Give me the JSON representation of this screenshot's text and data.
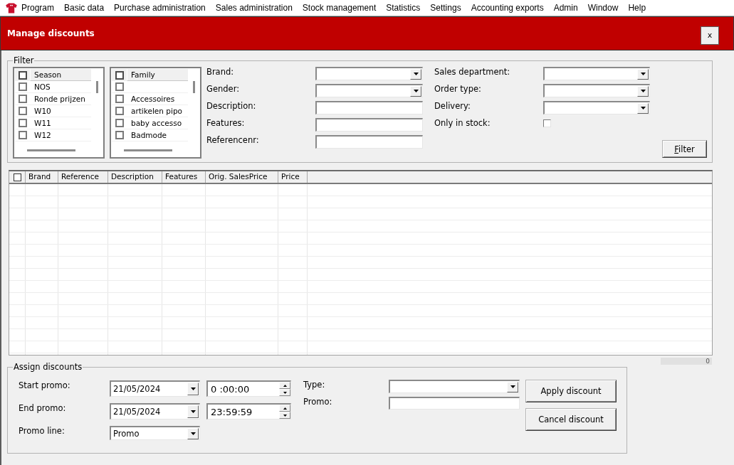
{
  "menu_bar": {
    "items": [
      "Program",
      "Basic data",
      "Purchase administration",
      "Sales administration",
      "Stock management",
      "Statistics",
      "Settings",
      "Accounting exports",
      "Admin",
      "Window",
      "Help"
    ]
  },
  "window": {
    "title": "Manage discounts",
    "close_button": "x"
  },
  "filter": {
    "legend": "Filter",
    "lists": [
      {
        "header": "Season",
        "header_checked": false,
        "items": [
          {
            "label": "NOS",
            "checked": false
          },
          {
            "label": "Ronde prijzen",
            "checked": false
          },
          {
            "label": "W10",
            "checked": false
          },
          {
            "label": "W11",
            "checked": false
          },
          {
            "label": "W12",
            "checked": false
          }
        ]
      },
      {
        "header": "Family",
        "header_checked": false,
        "items": [
          {
            "checked": false
          },
          {
            "label": "Accessoires",
            "checked": false
          },
          {
            "label": "artikelen pipo",
            "checked": false
          },
          {
            "label": "baby accesso",
            "checked": false
          },
          {
            "label": "Badmode",
            "checked": false
          }
        ]
      }
    ],
    "field_groups": [
      {
        "fields": [
          {
            "label": "Brand:",
            "kind": "combo"
          },
          {
            "label": "Gender:",
            "kind": "combo"
          },
          {
            "label": "Description:",
            "kind": "text"
          },
          {
            "label": "Features:",
            "kind": "text"
          },
          {
            "label": "Referencenr:",
            "kind": "text"
          }
        ]
      },
      {
        "fields": [
          {
            "label": "Sales department:",
            "kind": "combo"
          },
          {
            "label": "Order type:",
            "kind": "combo"
          },
          {
            "label": "Delivery:",
            "kind": "combo"
          },
          {
            "label": "Only in stock:",
            "kind": "checkbox",
            "checked": false
          }
        ]
      }
    ],
    "button": "Filter"
  },
  "table": {
    "select_all_checked": false,
    "columns": [
      "Brand",
      "Reference",
      "Description",
      "Features",
      "Orig. SalesPrice",
      "Price"
    ]
  },
  "row_count": "0",
  "assign": {
    "legend": "Assign discounts",
    "schedule": [
      {
        "label": "Start promo:",
        "date": "21/05/2024",
        "time": "0 :00:00"
      },
      {
        "label": "End promo:",
        "date": "21/05/2024",
        "time": "23:59:59"
      }
    ],
    "promo_line": {
      "label": "Promo line:",
      "value": "Promo"
    },
    "fields": [
      {
        "label": "Type:",
        "kind": "combo"
      },
      {
        "label": "Promo:",
        "kind": "text"
      }
    ],
    "buttons": [
      "Apply discount",
      "Cancel discount"
    ]
  }
}
